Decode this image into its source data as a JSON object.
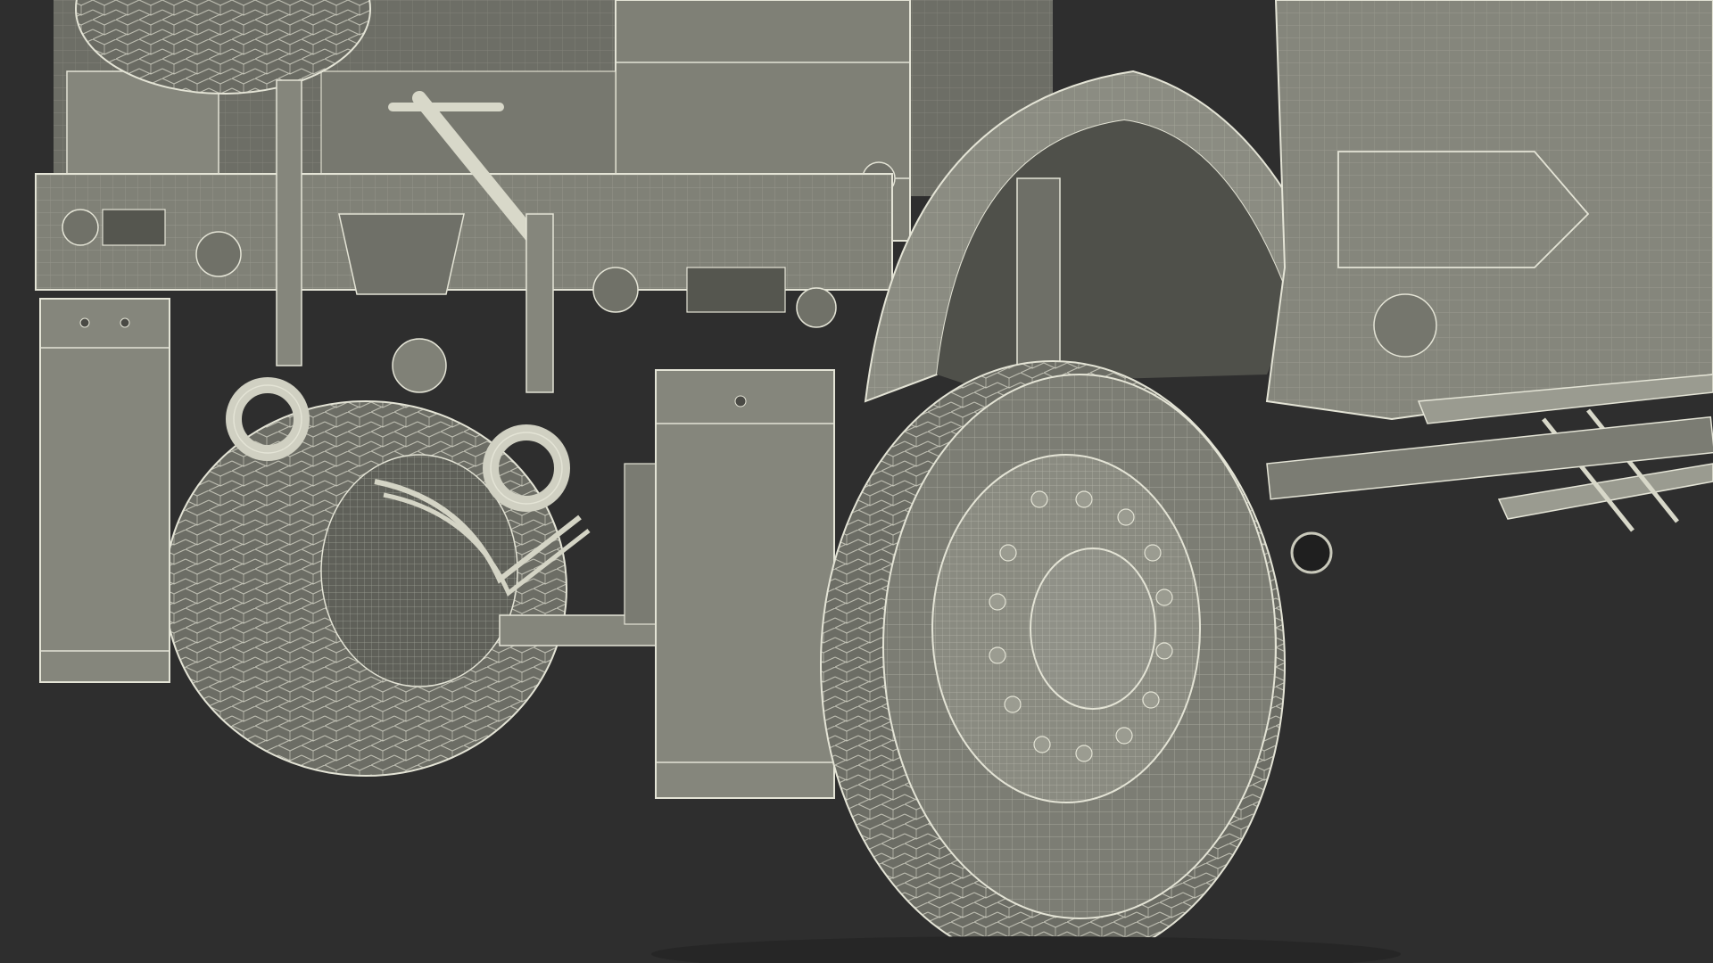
{
  "scene": {
    "subject": "wireframe-render-armored-vehicle-rear",
    "colors": {
      "background": "#2e2e2e",
      "surface": "#7d7e74",
      "surface_light": "#8f9086",
      "surface_dark": "#5e5f57",
      "shadow": "#3f403b",
      "wire": "#e4e4d6",
      "wire_dim": "#b9b9ab"
    }
  }
}
